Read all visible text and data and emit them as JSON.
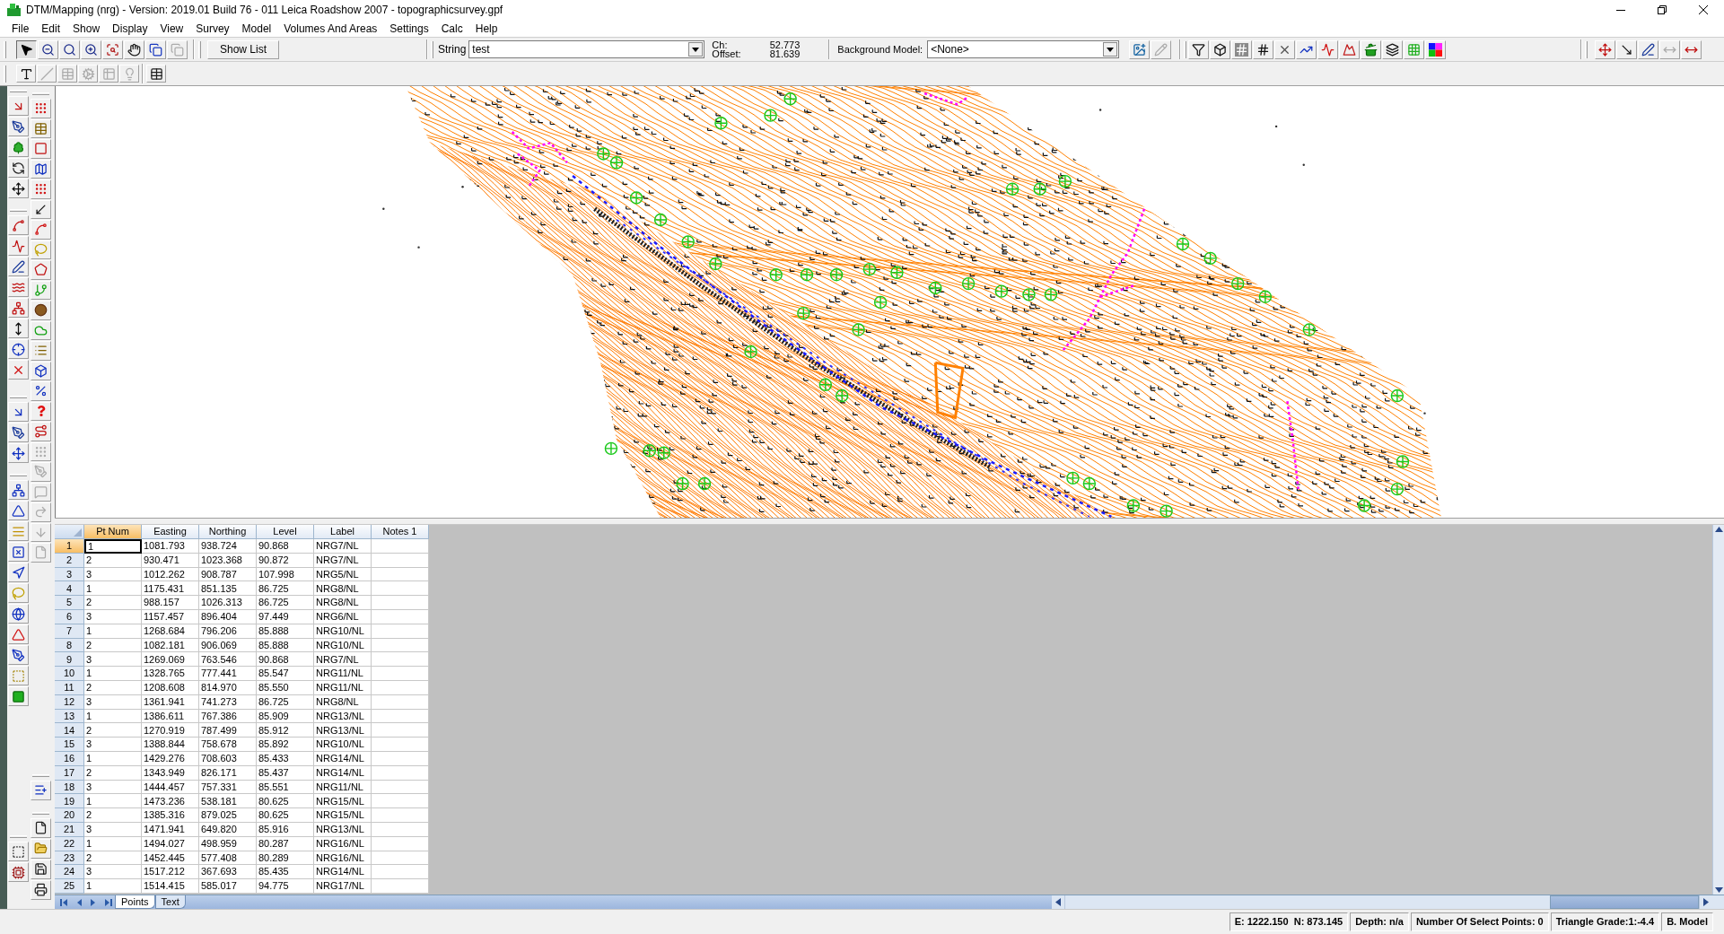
{
  "window": {
    "title": "DTM/Mapping (nrg) - Version: 2019.01 Build 76 - 011 Leica Roadshow 2007 - topographicsurvey.gpf"
  },
  "menu": [
    "File",
    "Edit",
    "Show",
    "Display",
    "View",
    "Survey",
    "Model",
    "Volumes And Areas",
    "Settings",
    "Calc",
    "Help"
  ],
  "toolbar": {
    "zoom_tools": [
      {
        "pressed": true,
        "disabled": false
      },
      {
        "pressed": false,
        "disabled": false
      },
      {
        "pressed": false,
        "disabled": false
      },
      {
        "pressed": false,
        "disabled": false
      },
      {
        "pressed": false,
        "disabled": false
      },
      {
        "pressed": false,
        "disabled": false
      },
      {
        "pressed": false,
        "disabled": false
      },
      {
        "pressed": false,
        "disabled": true
      }
    ],
    "show_list_button": "Show List",
    "string_label": "String",
    "string_value": "test",
    "ch_label": "Ch:",
    "ch_value": "52.773",
    "offset_label": "Offset:",
    "offset_value": "81.639",
    "background_model_label": "Background Model:",
    "background_model_value": "<None>",
    "model_tools": [
      {
        "disabled": false
      },
      {
        "disabled": true
      }
    ],
    "text_tools": [
      {
        "disabled": false
      },
      {
        "disabled": false
      },
      {
        "disabled": false
      },
      {
        "disabled": true
      },
      {
        "disabled": false
      }
    ]
  },
  "toolbar_2": {
    "tools": [
      {
        "disabled": false
      },
      {
        "disabled": true
      },
      {
        "disabled": true
      },
      {
        "disabled": true
      },
      {
        "disabled": true
      },
      {
        "disabled": true
      },
      {
        "disabled": false
      }
    ]
  },
  "side_toolbar": {
    "tools": [
      {
        "disabled": false
      },
      {
        "disabled": false
      },
      {
        "disabled": false
      },
      {
        "disabled": false
      },
      {
        "disabled": false
      },
      {
        "disabled": false
      },
      {
        "disabled": false
      },
      {
        "disabled": false
      },
      {
        "disabled": false
      },
      {
        "disabled": false
      },
      {
        "disabled": false
      },
      {
        "disabled": false
      },
      {
        "disabled": false
      },
      {
        "disabled": false
      },
      {
        "disabled": false
      },
      {
        "disabled": false
      },
      {
        "disabled": false
      },
      {
        "disabled": true
      },
      {
        "disabled": true
      },
      {
        "disabled": true
      },
      {
        "disabled": true
      },
      {
        "disabled": true
      },
      {
        "disabled": true
      }
    ]
  },
  "points_table": {
    "columns": [
      {
        "label": "Pt Num",
        "selected": true
      },
      {
        "label": "Easting",
        "selected": false
      },
      {
        "label": "Northing",
        "selected": false
      },
      {
        "label": "Level",
        "selected": false
      },
      {
        "label": "Label",
        "selected": false
      },
      {
        "label": "Notes 1",
        "selected": false
      }
    ],
    "rows": [
      {
        "number": "1",
        "selected": true,
        "cells": [
          "1",
          "1081.793",
          "938.724",
          "90.868",
          "NRG7/NL"
        ]
      },
      {
        "number": "2",
        "selected": false,
        "cells": [
          "2",
          "930.471",
          "1023.368",
          "90.872",
          "NRG7/NL"
        ]
      },
      {
        "number": "3",
        "selected": false,
        "cells": [
          "3",
          "1012.262",
          "908.787",
          "107.998",
          "NRG5/NL"
        ]
      },
      {
        "number": "4",
        "selected": false,
        "cells": [
          "1",
          "1175.431",
          "851.135",
          "86.725",
          "NRG8/NL"
        ]
      },
      {
        "number": "5",
        "selected": false,
        "cells": [
          "2",
          "988.157",
          "1026.313",
          "86.725",
          "NRG8/NL"
        ]
      },
      {
        "number": "6",
        "selected": false,
        "cells": [
          "3",
          "1157.457",
          "896.404",
          "97.449",
          "NRG6/NL"
        ]
      },
      {
        "number": "7",
        "selected": false,
        "cells": [
          "1",
          "1268.684",
          "796.206",
          "85.888",
          "NRG10/NL"
        ]
      },
      {
        "number": "8",
        "selected": false,
        "cells": [
          "2",
          "1082.181",
          "906.069",
          "85.888",
          "NRG10/NL"
        ]
      },
      {
        "number": "9",
        "selected": false,
        "cells": [
          "3",
          "1269.069",
          "763.546",
          "90.868",
          "NRG7/NL"
        ]
      },
      {
        "number": "10",
        "selected": false,
        "cells": [
          "1",
          "1328.765",
          "777.441",
          "85.547",
          "NRG11/NL"
        ]
      },
      {
        "number": "11",
        "selected": false,
        "cells": [
          "2",
          "1208.608",
          "814.970",
          "85.550",
          "NRG11/NL"
        ]
      },
      {
        "number": "12",
        "selected": false,
        "cells": [
          "3",
          "1361.941",
          "741.273",
          "86.725",
          "NRG8/NL"
        ]
      },
      {
        "number": "13",
        "selected": false,
        "cells": [
          "1",
          "1386.611",
          "767.386",
          "85.909",
          "NRG13/NL"
        ]
      },
      {
        "number": "14",
        "selected": false,
        "cells": [
          "2",
          "1270.919",
          "787.499",
          "85.912",
          "NRG13/NL"
        ]
      },
      {
        "number": "15",
        "selected": false,
        "cells": [
          "3",
          "1388.844",
          "758.678",
          "85.892",
          "NRG10/NL"
        ]
      },
      {
        "number": "16",
        "selected": false,
        "cells": [
          "1",
          "1429.276",
          "708.603",
          "85.433",
          "NRG14/NL"
        ]
      },
      {
        "number": "17",
        "selected": false,
        "cells": [
          "2",
          "1343.949",
          "826.171",
          "85.437",
          "NRG14/NL"
        ]
      },
      {
        "number": "18",
        "selected": false,
        "cells": [
          "3",
          "1444.457",
          "757.331",
          "85.551",
          "NRG11/NL"
        ]
      },
      {
        "number": "19",
        "selected": false,
        "cells": [
          "1",
          "1473.236",
          "538.181",
          "80.625",
          "NRG15/NL"
        ]
      },
      {
        "number": "20",
        "selected": false,
        "cells": [
          "2",
          "1385.316",
          "879.025",
          "80.625",
          "NRG15/NL"
        ]
      },
      {
        "number": "21",
        "selected": false,
        "cells": [
          "3",
          "1471.941",
          "649.820",
          "85.916",
          "NRG13/NL"
        ]
      },
      {
        "number": "22",
        "selected": false,
        "cells": [
          "1",
          "1494.027",
          "498.959",
          "80.287",
          "NRG16/NL"
        ]
      },
      {
        "number": "23",
        "selected": false,
        "cells": [
          "2",
          "1452.445",
          "577.408",
          "80.289",
          "NRG16/NL"
        ]
      },
      {
        "number": "24",
        "selected": false,
        "cells": [
          "3",
          "1517.212",
          "367.693",
          "85.435",
          "NRG14/NL"
        ]
      },
      {
        "number": "25",
        "selected": false,
        "cells": [
          "1",
          "1514.415",
          "585.017",
          "94.775",
          "NRG17/NL"
        ]
      }
    ]
  },
  "sheet_tabs": [
    {
      "label": "Points",
      "selected": true
    },
    {
      "label": "Text",
      "selected": false
    }
  ],
  "status_bar": [
    "E: 1222.150  N: 873.145",
    "Depth: n/a",
    "Number Of Select Points: 0",
    "Triangle Grade:1:-4.4",
    "B. Model"
  ]
}
